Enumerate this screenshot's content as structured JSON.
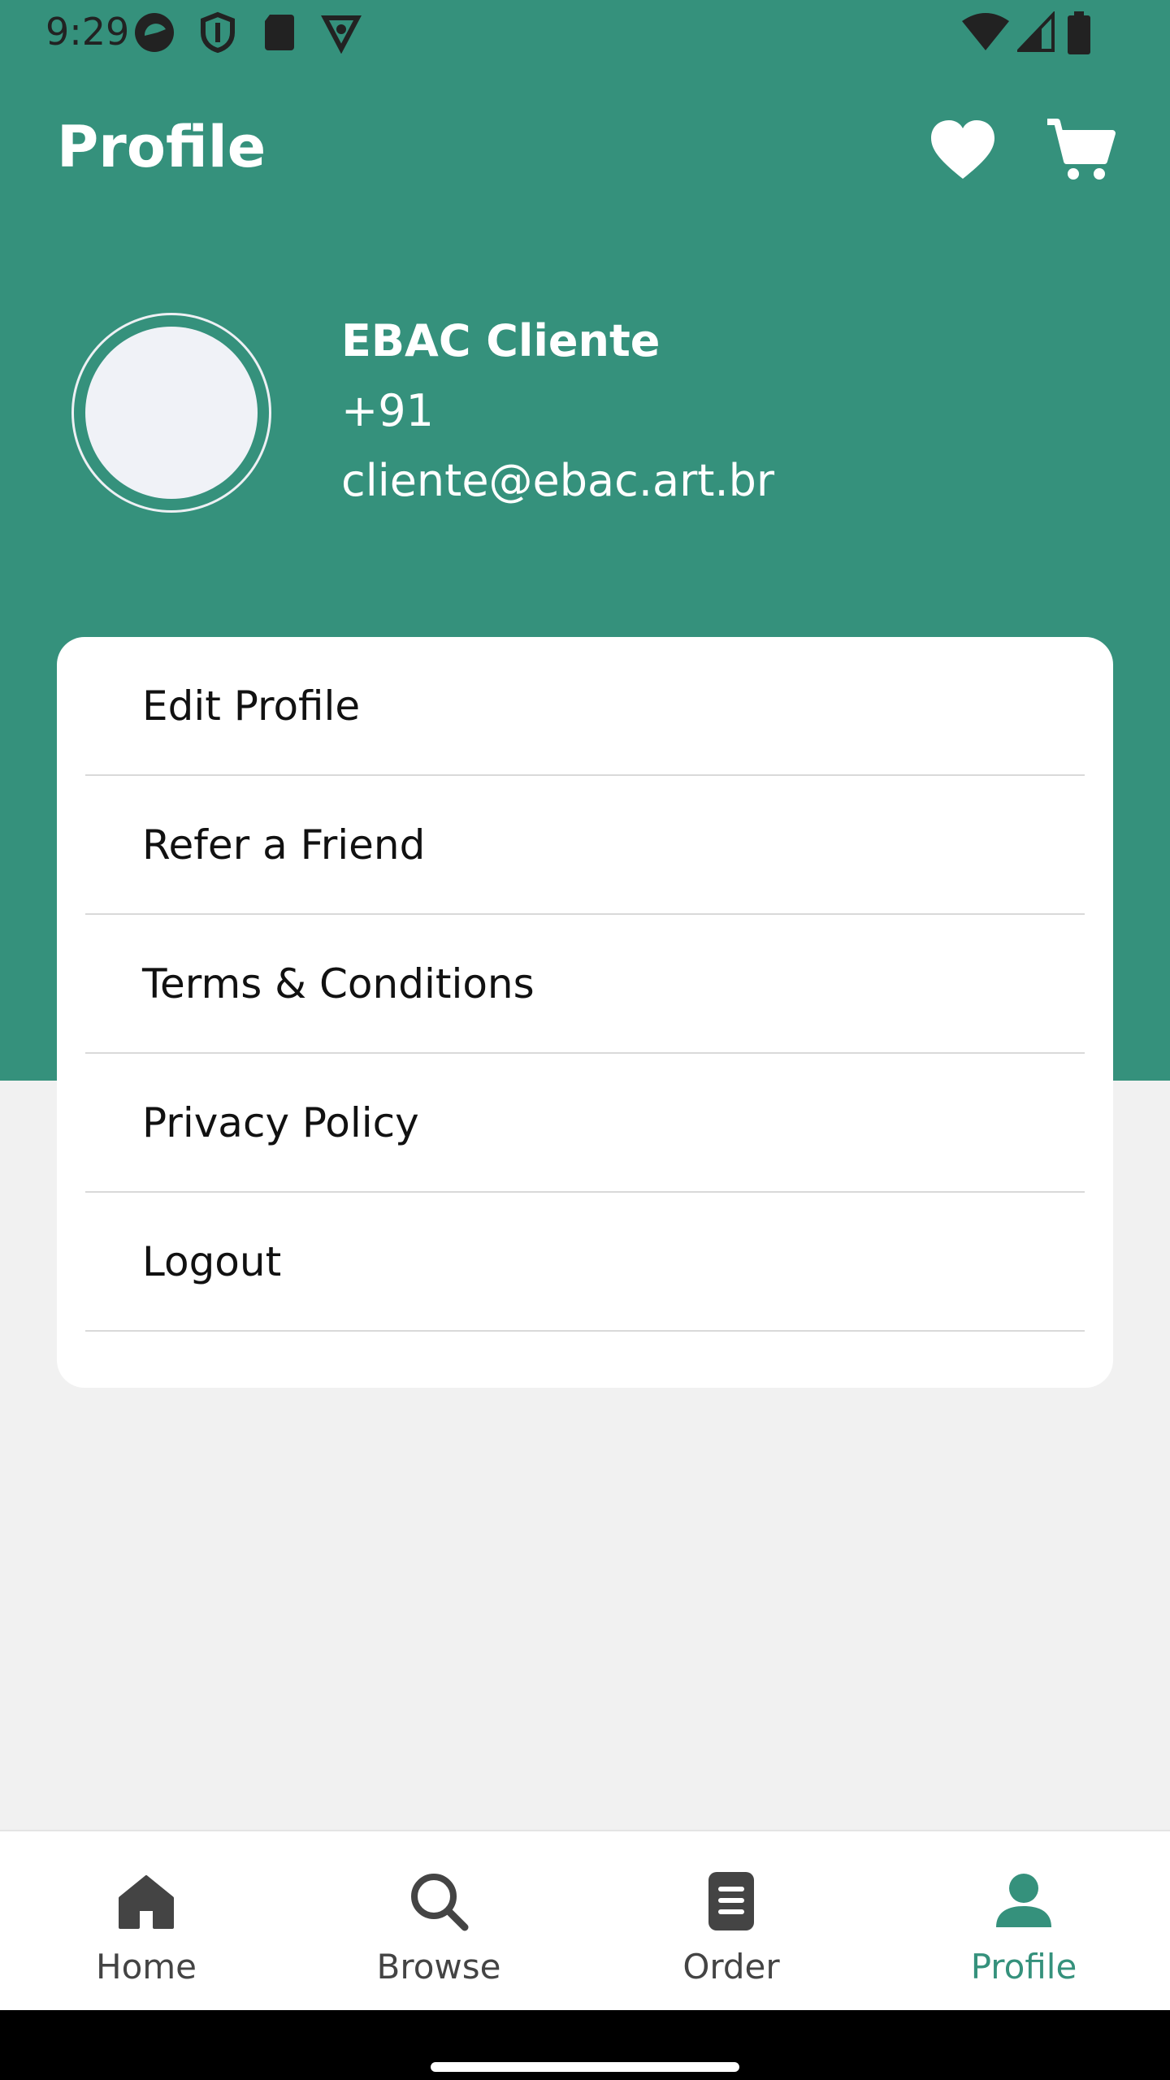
{
  "status_bar": {
    "time": "9:29",
    "left_icons": [
      "app-icon",
      "shield-icon",
      "sd-card-icon",
      "vpn-icon"
    ],
    "right_icons": [
      "wifi-icon",
      "signal-icon",
      "battery-icon"
    ]
  },
  "header": {
    "title": "Profile",
    "wishlist_icon": "heart-icon",
    "cart_icon": "cart-icon"
  },
  "profile": {
    "name": "EBAC Cliente",
    "phone": "+91",
    "email": "cliente@ebac.art.br"
  },
  "menu": {
    "items": [
      {
        "label": "Edit Profile"
      },
      {
        "label": "Refer a Friend"
      },
      {
        "label": "Terms & Conditions"
      },
      {
        "label": "Privacy Policy"
      },
      {
        "label": "Logout"
      }
    ]
  },
  "bottom_nav": {
    "items": [
      {
        "label": "Home",
        "icon": "home-icon"
      },
      {
        "label": "Browse",
        "icon": "search-icon"
      },
      {
        "label": "Order",
        "icon": "order-list-icon"
      },
      {
        "label": "Profile",
        "icon": "person-icon"
      }
    ],
    "active": "Profile"
  },
  "colors": {
    "brand": "#35917c",
    "background": "#f1f1f1",
    "card": "#ffffff"
  }
}
